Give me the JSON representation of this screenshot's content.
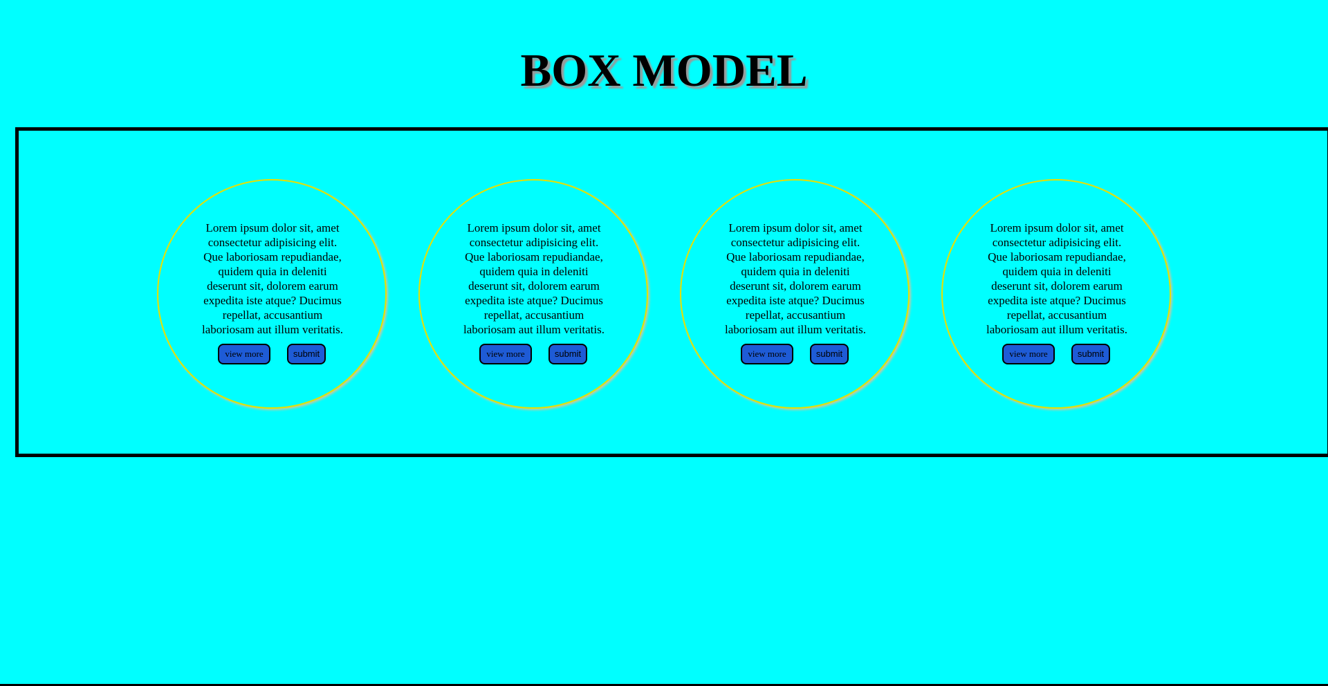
{
  "page": {
    "title": "BOX MODEL",
    "background_color": "#00ffff"
  },
  "cards": [
    {
      "text": "Lorem ipsum dolor sit, amet consectetur adipisicing elit. Que laboriosam repudiandae, quidem quia in deleniti deserunt sit, dolorem earum expedita iste atque? Ducimus repellat, accusantium laboriosam aut illum veritatis.",
      "view_more_label": "view more",
      "submit_label": "submit"
    },
    {
      "text": "Lorem ipsum dolor sit, amet consectetur adipisicing elit. Que laboriosam repudiandae, quidem quia in deleniti deserunt sit, dolorem earum expedita iste atque? Ducimus repellat, accusantium laboriosam aut illum veritatis.",
      "view_more_label": "view more",
      "submit_label": "submit"
    },
    {
      "text": "Lorem ipsum dolor sit, amet consectetur adipisicing elit. Que laboriosam repudiandae, quidem quia in deleniti deserunt sit, dolorem earum expedita iste atque? Ducimus repellat, accusantium laboriosam aut illum veritatis.",
      "view_more_label": "view more",
      "submit_label": "submit"
    },
    {
      "text": "Lorem ipsum dolor sit, amet consectetur adipisicing elit. Que laboriosam repudiandae, quidem quia in deleniti deserunt sit, dolorem earum expedita iste atque? Ducimus repellat, accusantium laboriosam aut illum veritatis.",
      "view_more_label": "view more",
      "submit_label": "submit"
    }
  ],
  "colors": {
    "frame_border": "#000000",
    "card_border": "#e8e000",
    "button_background": "#1e5bd6"
  }
}
